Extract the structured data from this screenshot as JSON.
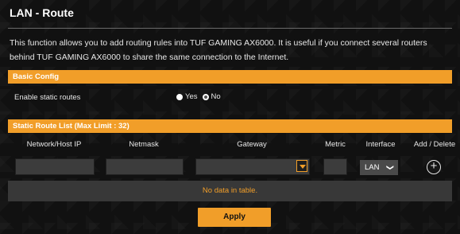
{
  "page": {
    "title": "LAN - Route",
    "description": "This function allows you to add routing rules into TUF GAMING AX6000. It is useful if you connect several routers behind TUF GAMING AX6000 to share the same connection to the Internet."
  },
  "basic_config": {
    "header": "Basic Config",
    "enable_label": "Enable static routes",
    "yes_label": "Yes",
    "no_label": "No",
    "selected": "No"
  },
  "route_list": {
    "header": "Static Route List (Max Limit : 32)",
    "columns": {
      "network": "Network/Host IP",
      "netmask": "Netmask",
      "gateway": "Gateway",
      "metric": "Metric",
      "interface": "Interface",
      "add_delete": "Add / Delete"
    },
    "network_value": "",
    "netmask_value": "",
    "gateway_value": "",
    "metric_value": "",
    "interface_value": "LAN",
    "empty_message": "No data in table."
  },
  "actions": {
    "apply_label": "Apply"
  },
  "colors": {
    "accent": "#f19e29",
    "background": "#111111",
    "input_bg": "#3c3c3c"
  }
}
